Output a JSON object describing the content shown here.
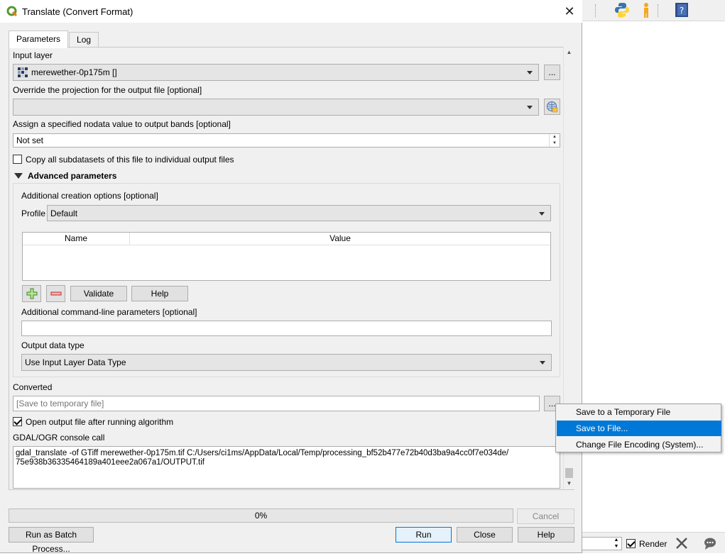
{
  "window": {
    "title": "Translate (Convert Format)",
    "close_glyph": "✕"
  },
  "tabs": [
    {
      "label": "Parameters",
      "active": true
    },
    {
      "label": "Log",
      "active": false
    }
  ],
  "input_layer": {
    "label": "Input layer",
    "value": "merewether-0p175m []",
    "browse": "..."
  },
  "override_projection": {
    "label": "Override the projection for the output file [optional]",
    "value": ""
  },
  "nodata": {
    "label": "Assign a specified nodata value to output bands [optional]",
    "value": "Not set"
  },
  "copy_subdatasets": {
    "label": "Copy all subdatasets of this file to individual output files",
    "checked": false
  },
  "advanced": {
    "title": "Advanced parameters",
    "creation_options_label": "Additional creation options [optional]",
    "profile_label": "Profile",
    "profile_value": "Default",
    "table_headers": [
      "Name",
      "Value"
    ],
    "validate": "Validate",
    "help": "Help",
    "cmdline_label": "Additional command-line parameters [optional]",
    "cmdline_value": "",
    "datatype_label": "Output data type",
    "datatype_value": "Use Input Layer Data Type"
  },
  "converted": {
    "label": "Converted",
    "placeholder": "[Save to temporary file]",
    "browse": "..."
  },
  "open_output": {
    "label": "Open output file after running algorithm",
    "checked": true
  },
  "console": {
    "label": "GDAL/OGR console call",
    "text": "gdal_translate -of GTiff merewether-0p175m.tif C:/Users/ci1ms/AppData/Local/Temp/processing_bf52b477e72b40d3ba9a4cc0f7e034de/\n75e938b36335464189a401eee2a067a1/OUTPUT.tif"
  },
  "progress": {
    "label": "0%",
    "value": 0
  },
  "buttons": {
    "cancel": "Cancel",
    "batch": "Run as Batch Process...",
    "run": "Run",
    "close": "Close",
    "help": "Help"
  },
  "context_menu": {
    "items": [
      "Save to a Temporary File",
      "Save to File...",
      "Change File Encoding (System)..."
    ],
    "highlighted": 1
  },
  "statusbar": {
    "render_label": "Render",
    "render_checked": true
  },
  "colors": {
    "accent": "#0078d7",
    "dialog_bg": "#f0f0f0"
  }
}
